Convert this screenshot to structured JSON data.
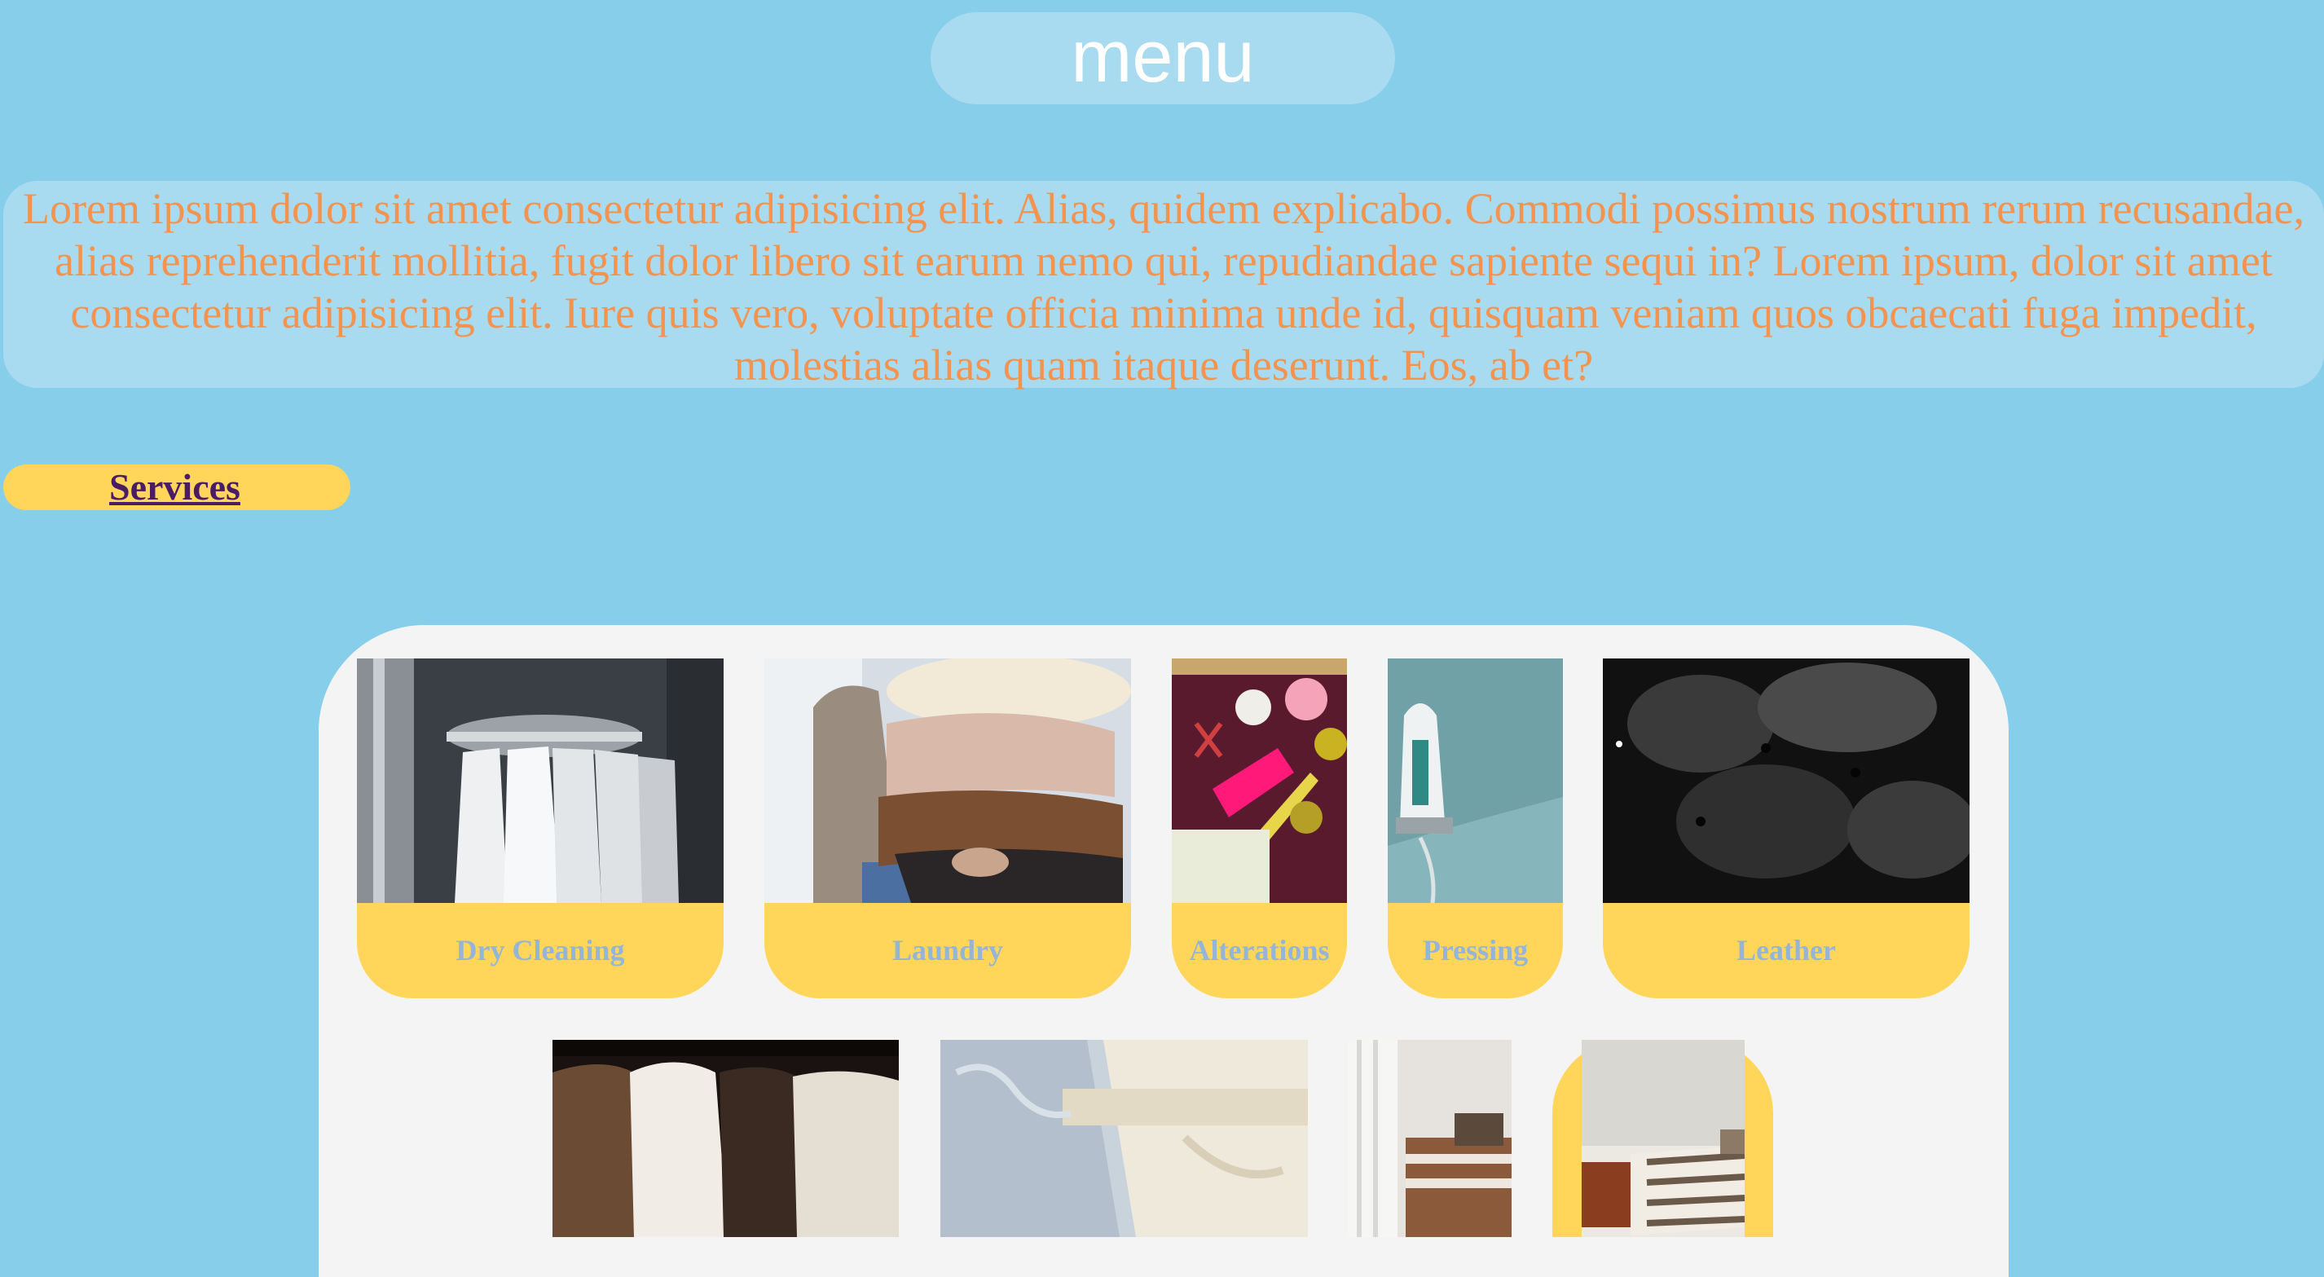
{
  "header": {
    "menu_label": "menu"
  },
  "intro": {
    "text": "Lorem ipsum dolor sit amet consectetur adipisicing elit. Alias, quidem explicabo. Commodi possimus nostrum rerum recusandae, alias reprehenderit mollitia, fugit dolor libero sit earum nemo qui, repudiandae sapiente sequi in? Lorem ipsum, dolor sit amet consectetur adipisicing elit. Iure quis vero, voluptate officia minima unde id, quisquam veniam quos obcaecati fuga impedit, molestias alias quam itaque deserunt. Eos, ab et?"
  },
  "services_link": {
    "label": "Services"
  },
  "services": [
    {
      "label": "Dry Cleaning",
      "image": "dry-cleaning-photo"
    },
    {
      "label": "Laundry",
      "image": "laundry-photo"
    },
    {
      "label": "Alterations",
      "image": "alterations-photo"
    },
    {
      "label": "Pressing",
      "image": "pressing-photo"
    },
    {
      "label": "Leather",
      "image": "leather-photo"
    },
    {
      "label": "",
      "image": "fur-coats-photo"
    },
    {
      "label": "",
      "image": "wedding-dress-photo"
    },
    {
      "label": "",
      "image": "window-curtains-photo"
    },
    {
      "label": "",
      "image": "bedding-photo"
    }
  ],
  "colors": {
    "background": "#87ceeb",
    "accent_yellow": "#ffd55a",
    "intro_text": "#f4934e",
    "caption_text": "#94b4d8",
    "link_text": "#4a1c66",
    "panel": "#f4f4f4"
  }
}
